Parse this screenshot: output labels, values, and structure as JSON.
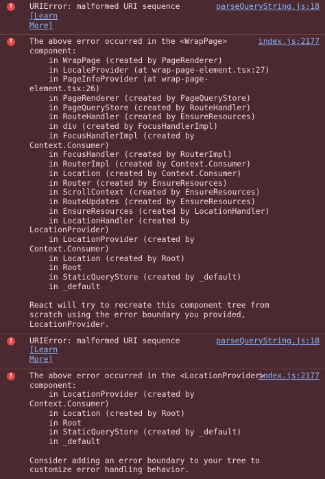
{
  "entries": [
    {
      "text": "URIError: malformed URI sequence ",
      "learn": [
        "[Learn",
        "More]"
      ],
      "source": "parseQueryString.js:18"
    },
    {
      "header": "The above error occurred in the <WrapPage>",
      "source": "index.js:2177",
      "lines": [
        "component:",
        "in WrapPage (created by PageRenderer)",
        "in LocaleProvider (at wrap-page-element.tsx:27)",
        "in PageInfoProvider (at wrap-page-",
        "element.tsx:26)",
        "in PageRenderer (created by PageQueryStore)",
        "in PageQueryStore (created by RouteHandler)",
        "in RouteHandler (created by EnsureResources)",
        "in div (created by FocusHandlerImpl)",
        "in FocusHandlerImpl (created by",
        "Context.Consumer)",
        "in FocusHandler (created by RouterImpl)",
        "in RouterImpl (created by Context.Consumer)",
        "in Location (created by Context.Consumer)",
        "in Router (created by EnsureResources)",
        "in ScrollContext (created by EnsureResources)",
        "in RouteUpdates (created by EnsureResources)",
        "in EnsureResources (created by LocationHandler)",
        "in LocationHandler (created by",
        "LocationProvider)",
        "in LocationProvider (created by",
        "Context.Consumer)",
        "in Location (created by Root)",
        "in Root",
        "in StaticQueryStore (created by _default)",
        "in _default"
      ],
      "footer": [
        "React will try to recreate this component tree from",
        "scratch using the error boundary you provided,",
        "LocationProvider."
      ]
    },
    {
      "text": "URIError: malformed URI sequence ",
      "learn": [
        "[Learn",
        "More]"
      ],
      "source": "parseQueryString.js:18"
    },
    {
      "header": "The above error occurred in the <LocationProvider>",
      "source": "index.js:2177",
      "lines": [
        "component:",
        "in LocationProvider (created by",
        "Context.Consumer)",
        "in Location (created by Root)",
        "in Root",
        "in StaticQueryStore (created by _default)",
        "in _default"
      ],
      "footer": [
        "Consider adding an error boundary to your tree to",
        "customize error handling behavior."
      ]
    }
  ],
  "icon_glyph": "!",
  "colors": {
    "background": "#4a2a30",
    "text": "#f0d8dc",
    "link": "#8cb4ff",
    "icon": "#e84545"
  }
}
